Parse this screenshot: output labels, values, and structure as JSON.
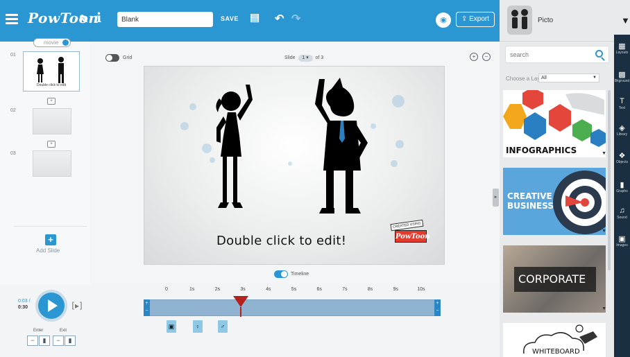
{
  "app": {
    "logo": "PowToon",
    "title_value": "Blank",
    "save_label": "SAVE",
    "export_label": "Export",
    "brand_color": "#2a96d2"
  },
  "user": {
    "name": "Picto"
  },
  "left_panel": {
    "movie_toggle_label": "movie",
    "slides": [
      {
        "number": "01",
        "caption": "Double click to edit",
        "active": true
      },
      {
        "number": "02",
        "caption": "",
        "active": false
      },
      {
        "number": "03",
        "caption": "",
        "active": false
      }
    ],
    "add_slide_label": "Add Slide"
  },
  "canvas": {
    "grid_label": "Grid",
    "slide_prefix": "Slide",
    "slide_current": "1",
    "slide_of": "of 3",
    "caption": "Double click to edit!",
    "badge_top": "CREATED USING",
    "badge_main": "PowToon",
    "timeline_label": "Timeline"
  },
  "playback": {
    "current_time": "0:03 /",
    "total_time": "0:30",
    "enter_label": "Enter",
    "exit_label": "Exit"
  },
  "timeline": {
    "ticks": [
      "0",
      "1s",
      "2s",
      "3s",
      "4s",
      "5s",
      "6s",
      "7s",
      "8s",
      "9s",
      "10s"
    ],
    "playhead_seconds": 3
  },
  "right_panel": {
    "search_placeholder": "search",
    "layout_label": "Choose a Layout",
    "layout_filter": "All",
    "layouts": [
      {
        "title": "INFOGRAPHICS"
      },
      {
        "title": "CREATIVE BUSINESS"
      },
      {
        "title": "CORPORATE"
      },
      {
        "title": "WHITEBOARD"
      }
    ]
  },
  "tools": [
    {
      "label": "Layouts",
      "icon": "layouts-icon"
    },
    {
      "label": "Bkground",
      "icon": "background-icon"
    },
    {
      "label": "Text",
      "icon": "text-icon"
    },
    {
      "label": "Library",
      "icon": "library-icon"
    },
    {
      "label": "Objects",
      "icon": "objects-icon"
    },
    {
      "label": "Graphs",
      "icon": "graphs-icon"
    },
    {
      "label": "Sound",
      "icon": "sound-icon"
    },
    {
      "label": "Images",
      "icon": "images-icon"
    }
  ]
}
